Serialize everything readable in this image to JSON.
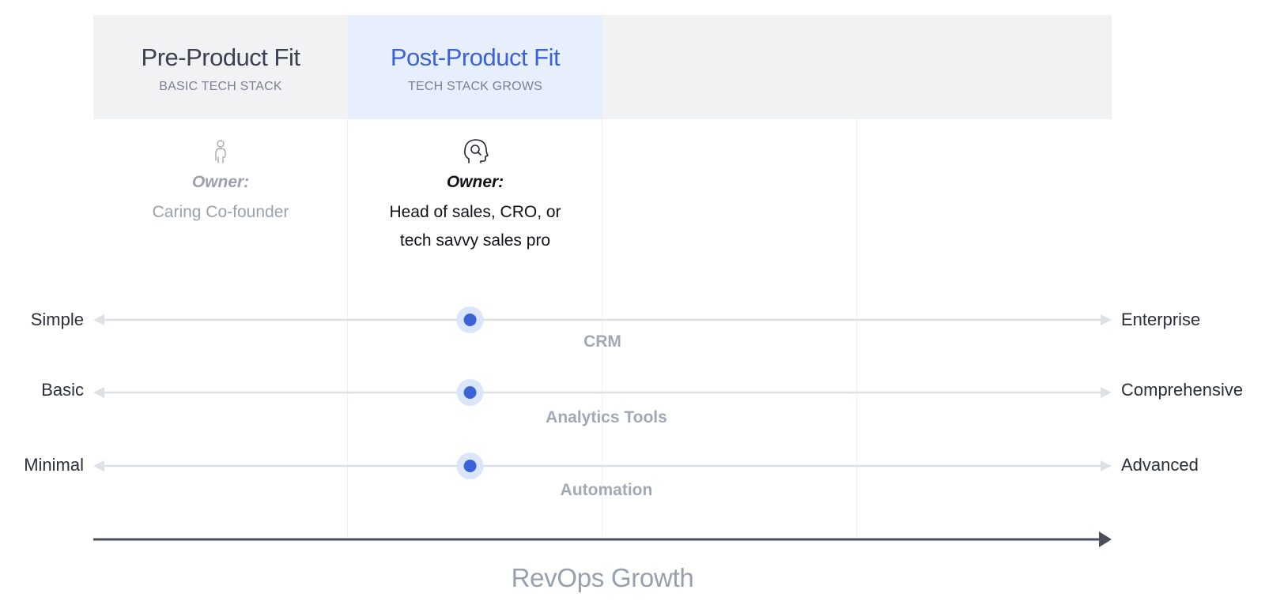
{
  "stages": [
    {
      "title": "Pre-Product Fit",
      "subtitle": "BASIC TECH STACK",
      "owner_label": "Owner:",
      "owner": "Caring Co-founder",
      "icon": "person-icon"
    },
    {
      "title": "Post-Product Fit",
      "subtitle": "TECH STACK GROWS",
      "owner_label": "Owner:",
      "owner": "Head of sales, CRO, or tech savvy sales pro",
      "icon": "head-gear-icon"
    },
    {
      "title": "",
      "subtitle": ""
    },
    {
      "title": "",
      "subtitle": ""
    }
  ],
  "scales": [
    {
      "category": "CRM",
      "left": "Simple",
      "right": "Enterprise",
      "position": 0.37
    },
    {
      "category": "Analytics Tools",
      "left": "Basic",
      "right": "Comprehensive",
      "position": 0.37
    },
    {
      "category": "Automation",
      "left": "Minimal",
      "right": "Advanced",
      "position": 0.37
    }
  ],
  "growth_axis_label": "RevOps Growth",
  "colors": {
    "accent": "#3b63d6",
    "header_bg": "#f1f2f4",
    "active_header_bg": "#e7effd",
    "marker_halo": "#dbe5fb",
    "scale_line": "#dde0e5",
    "growth_axis": "#4a4f5c"
  }
}
